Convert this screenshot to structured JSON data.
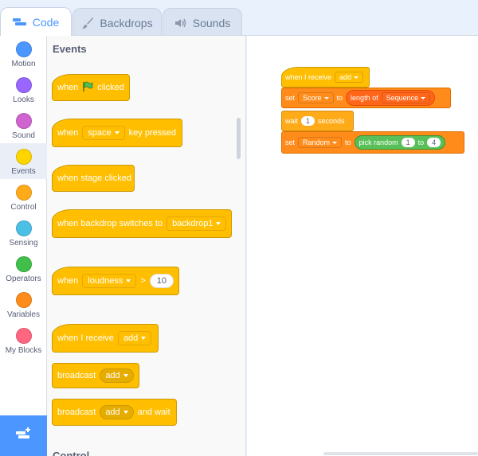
{
  "tabs": {
    "code": "Code",
    "backdrops": "Backdrops",
    "sounds": "Sounds"
  },
  "categories": [
    {
      "label": "Motion",
      "color": "#4c97ff"
    },
    {
      "label": "Looks",
      "color": "#9966ff"
    },
    {
      "label": "Sound",
      "color": "#cf63cf"
    },
    {
      "label": "Events",
      "color": "#ffd500"
    },
    {
      "label": "Control",
      "color": "#ffab19"
    },
    {
      "label": "Sensing",
      "color": "#4cbfe6"
    },
    {
      "label": "Operators",
      "color": "#40bf4a"
    },
    {
      "label": "Variables",
      "color": "#ff8c1a"
    },
    {
      "label": "My Blocks",
      "color": "#ff6680"
    }
  ],
  "palette": {
    "title": "Events",
    "next_title": "Control",
    "flag_block": {
      "when": "when",
      "clicked": "clicked"
    },
    "key_block": {
      "when": "when",
      "key": "space",
      "suffix": "key pressed"
    },
    "stage_block": {
      "label": "when stage clicked"
    },
    "backdrop_block": {
      "prefix": "when backdrop switches to",
      "backdrop": "backdrop1"
    },
    "loudness_block": {
      "when": "when",
      "sensor": "loudness",
      "op": ">",
      "value": "10"
    },
    "receive_block": {
      "prefix": "when I receive",
      "message": "add"
    },
    "broadcast_block": {
      "prefix": "broadcast",
      "message": "add"
    },
    "broadcast_wait_block": {
      "prefix": "broadcast",
      "message": "add",
      "suffix": "and wait"
    }
  },
  "script": {
    "hat": {
      "prefix": "when I receive",
      "message": "add"
    },
    "set1": {
      "set": "set",
      "variable": "Score",
      "to": "to",
      "op": "length of",
      "list": "Sequence"
    },
    "wait": {
      "wait": "wait",
      "value": "1",
      "unit": "seconds"
    },
    "set2": {
      "set": "set",
      "variable": "Random",
      "to": "to",
      "op": "pick random",
      "from": "1",
      "to_word": "to",
      "to_value": "4"
    }
  }
}
